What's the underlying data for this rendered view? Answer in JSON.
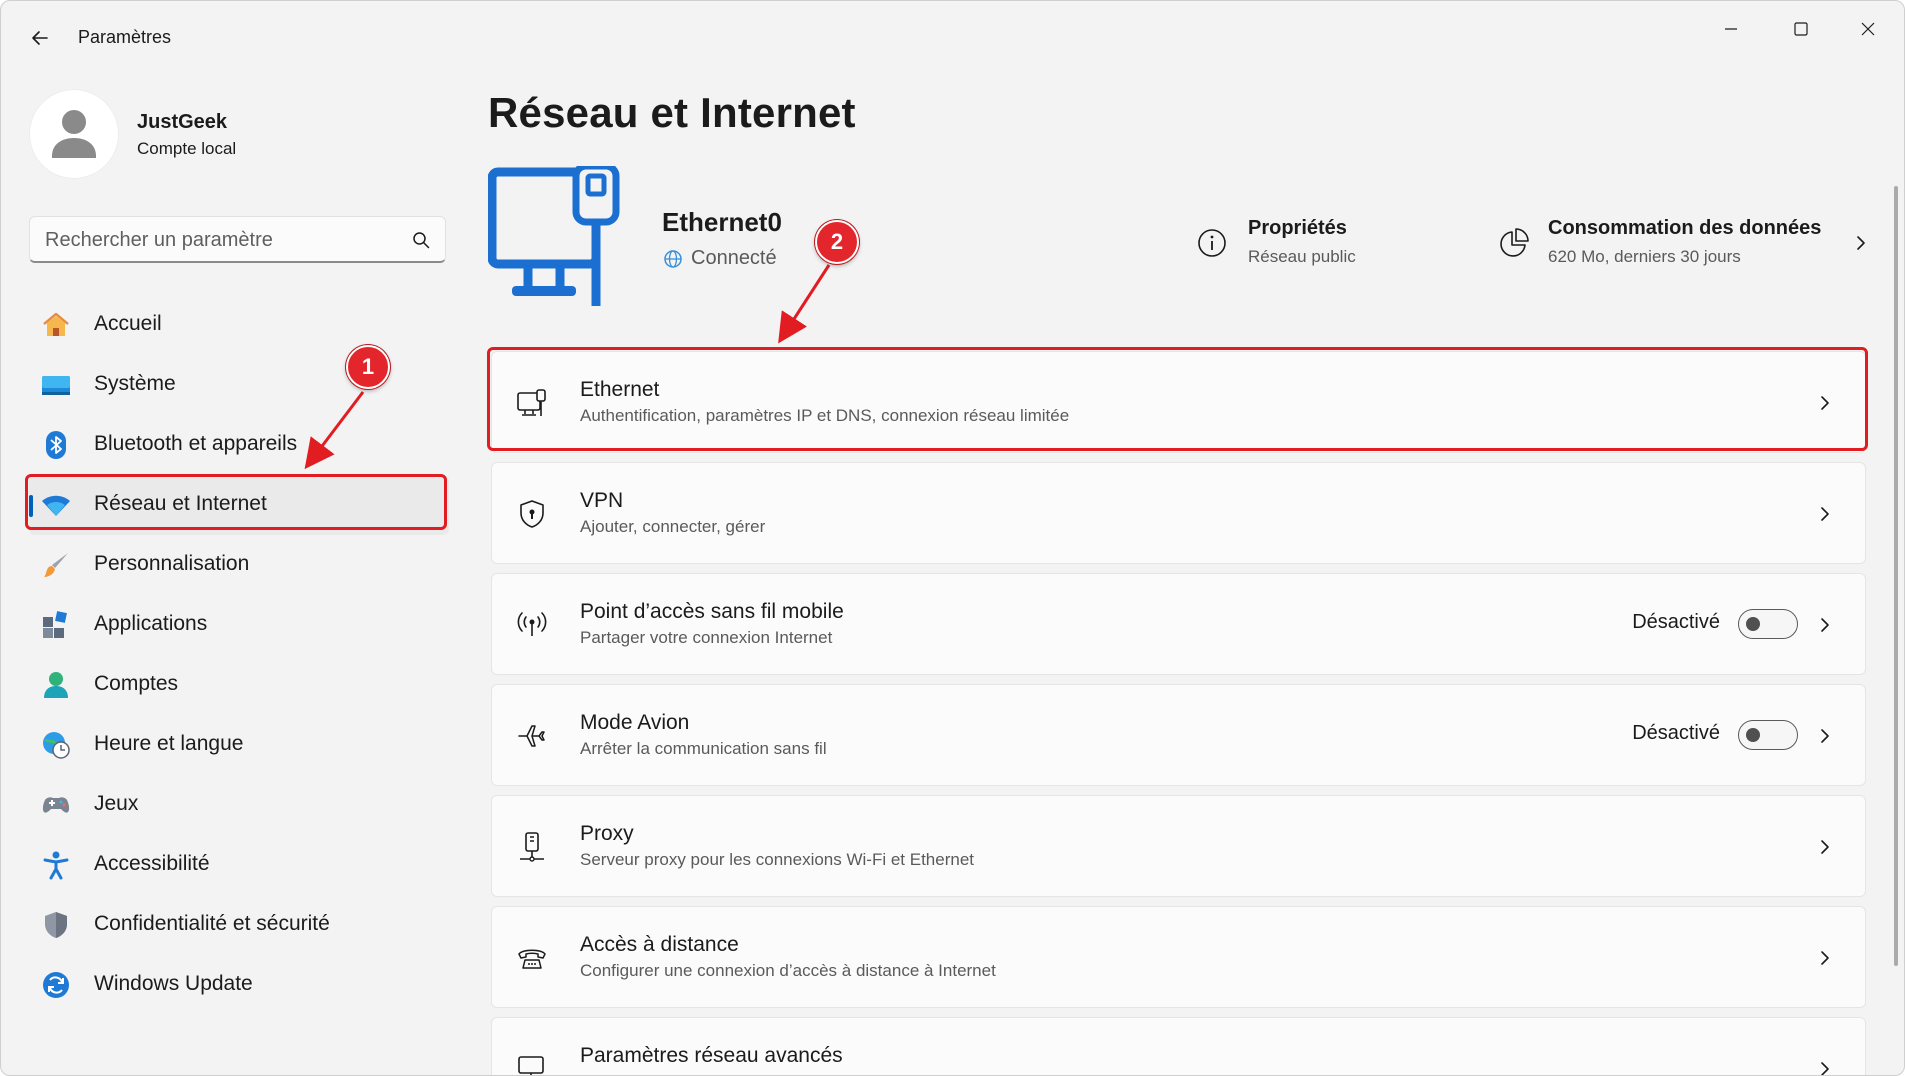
{
  "window": {
    "title": "Paramètres"
  },
  "profile": {
    "name": "JustGeek",
    "account_type": "Compte local"
  },
  "search": {
    "placeholder": "Rechercher un paramètre"
  },
  "sidebar": {
    "items": [
      {
        "label": "Accueil",
        "icon": "home-icon"
      },
      {
        "label": "Système",
        "icon": "system-icon"
      },
      {
        "label": "Bluetooth et appareils",
        "icon": "bluetooth-icon"
      },
      {
        "label": "Réseau et Internet",
        "icon": "wifi-icon",
        "active": true
      },
      {
        "label": "Personnalisation",
        "icon": "brush-icon"
      },
      {
        "label": "Applications",
        "icon": "apps-icon"
      },
      {
        "label": "Comptes",
        "icon": "account-icon"
      },
      {
        "label": "Heure et langue",
        "icon": "clock-globe-icon"
      },
      {
        "label": "Jeux",
        "icon": "gamepad-icon"
      },
      {
        "label": "Accessibilité",
        "icon": "accessibility-icon"
      },
      {
        "label": "Confidentialité et sécurité",
        "icon": "shield-icon"
      },
      {
        "label": "Windows Update",
        "icon": "update-icon"
      }
    ]
  },
  "main": {
    "title": "Réseau et Internet",
    "adapter": {
      "name": "Ethernet0",
      "status": "Connecté"
    },
    "properties": {
      "title": "Propriétés",
      "subtitle": "Réseau public"
    },
    "data_usage": {
      "title": "Consommation des données",
      "subtitle": "620 Mo, derniers 30 jours"
    },
    "cards": [
      {
        "title": "Ethernet",
        "subtitle": "Authentification, paramètres IP et DNS, connexion réseau limitée",
        "icon": "ethernet-icon"
      },
      {
        "title": "VPN",
        "subtitle": "Ajouter, connecter, gérer",
        "icon": "vpn-shield-icon"
      },
      {
        "title": "Point d’accès sans fil mobile",
        "subtitle": "Partager votre connexion Internet",
        "icon": "hotspot-icon",
        "toggle_label": "Désactivé",
        "toggle_on": false
      },
      {
        "title": "Mode Avion",
        "subtitle": "Arrêter la communication sans fil",
        "icon": "airplane-icon",
        "toggle_label": "Désactivé",
        "toggle_on": false
      },
      {
        "title": "Proxy",
        "subtitle": "Serveur proxy pour les connexions Wi-Fi et Ethernet",
        "icon": "proxy-icon"
      },
      {
        "title": "Accès à distance",
        "subtitle": "Configurer une connexion d’accès à distance à Internet",
        "icon": "dialup-icon"
      },
      {
        "title": "Paramètres réseau avancés",
        "subtitle": "",
        "icon": "advanced-network-icon"
      }
    ]
  },
  "annotations": {
    "marker_1": "1",
    "marker_2": "2",
    "color": "#e11d22"
  },
  "colors": {
    "accent": "#005fb8",
    "window_bg": "#f3f3f3",
    "card_bg": "#fbfbfb"
  }
}
